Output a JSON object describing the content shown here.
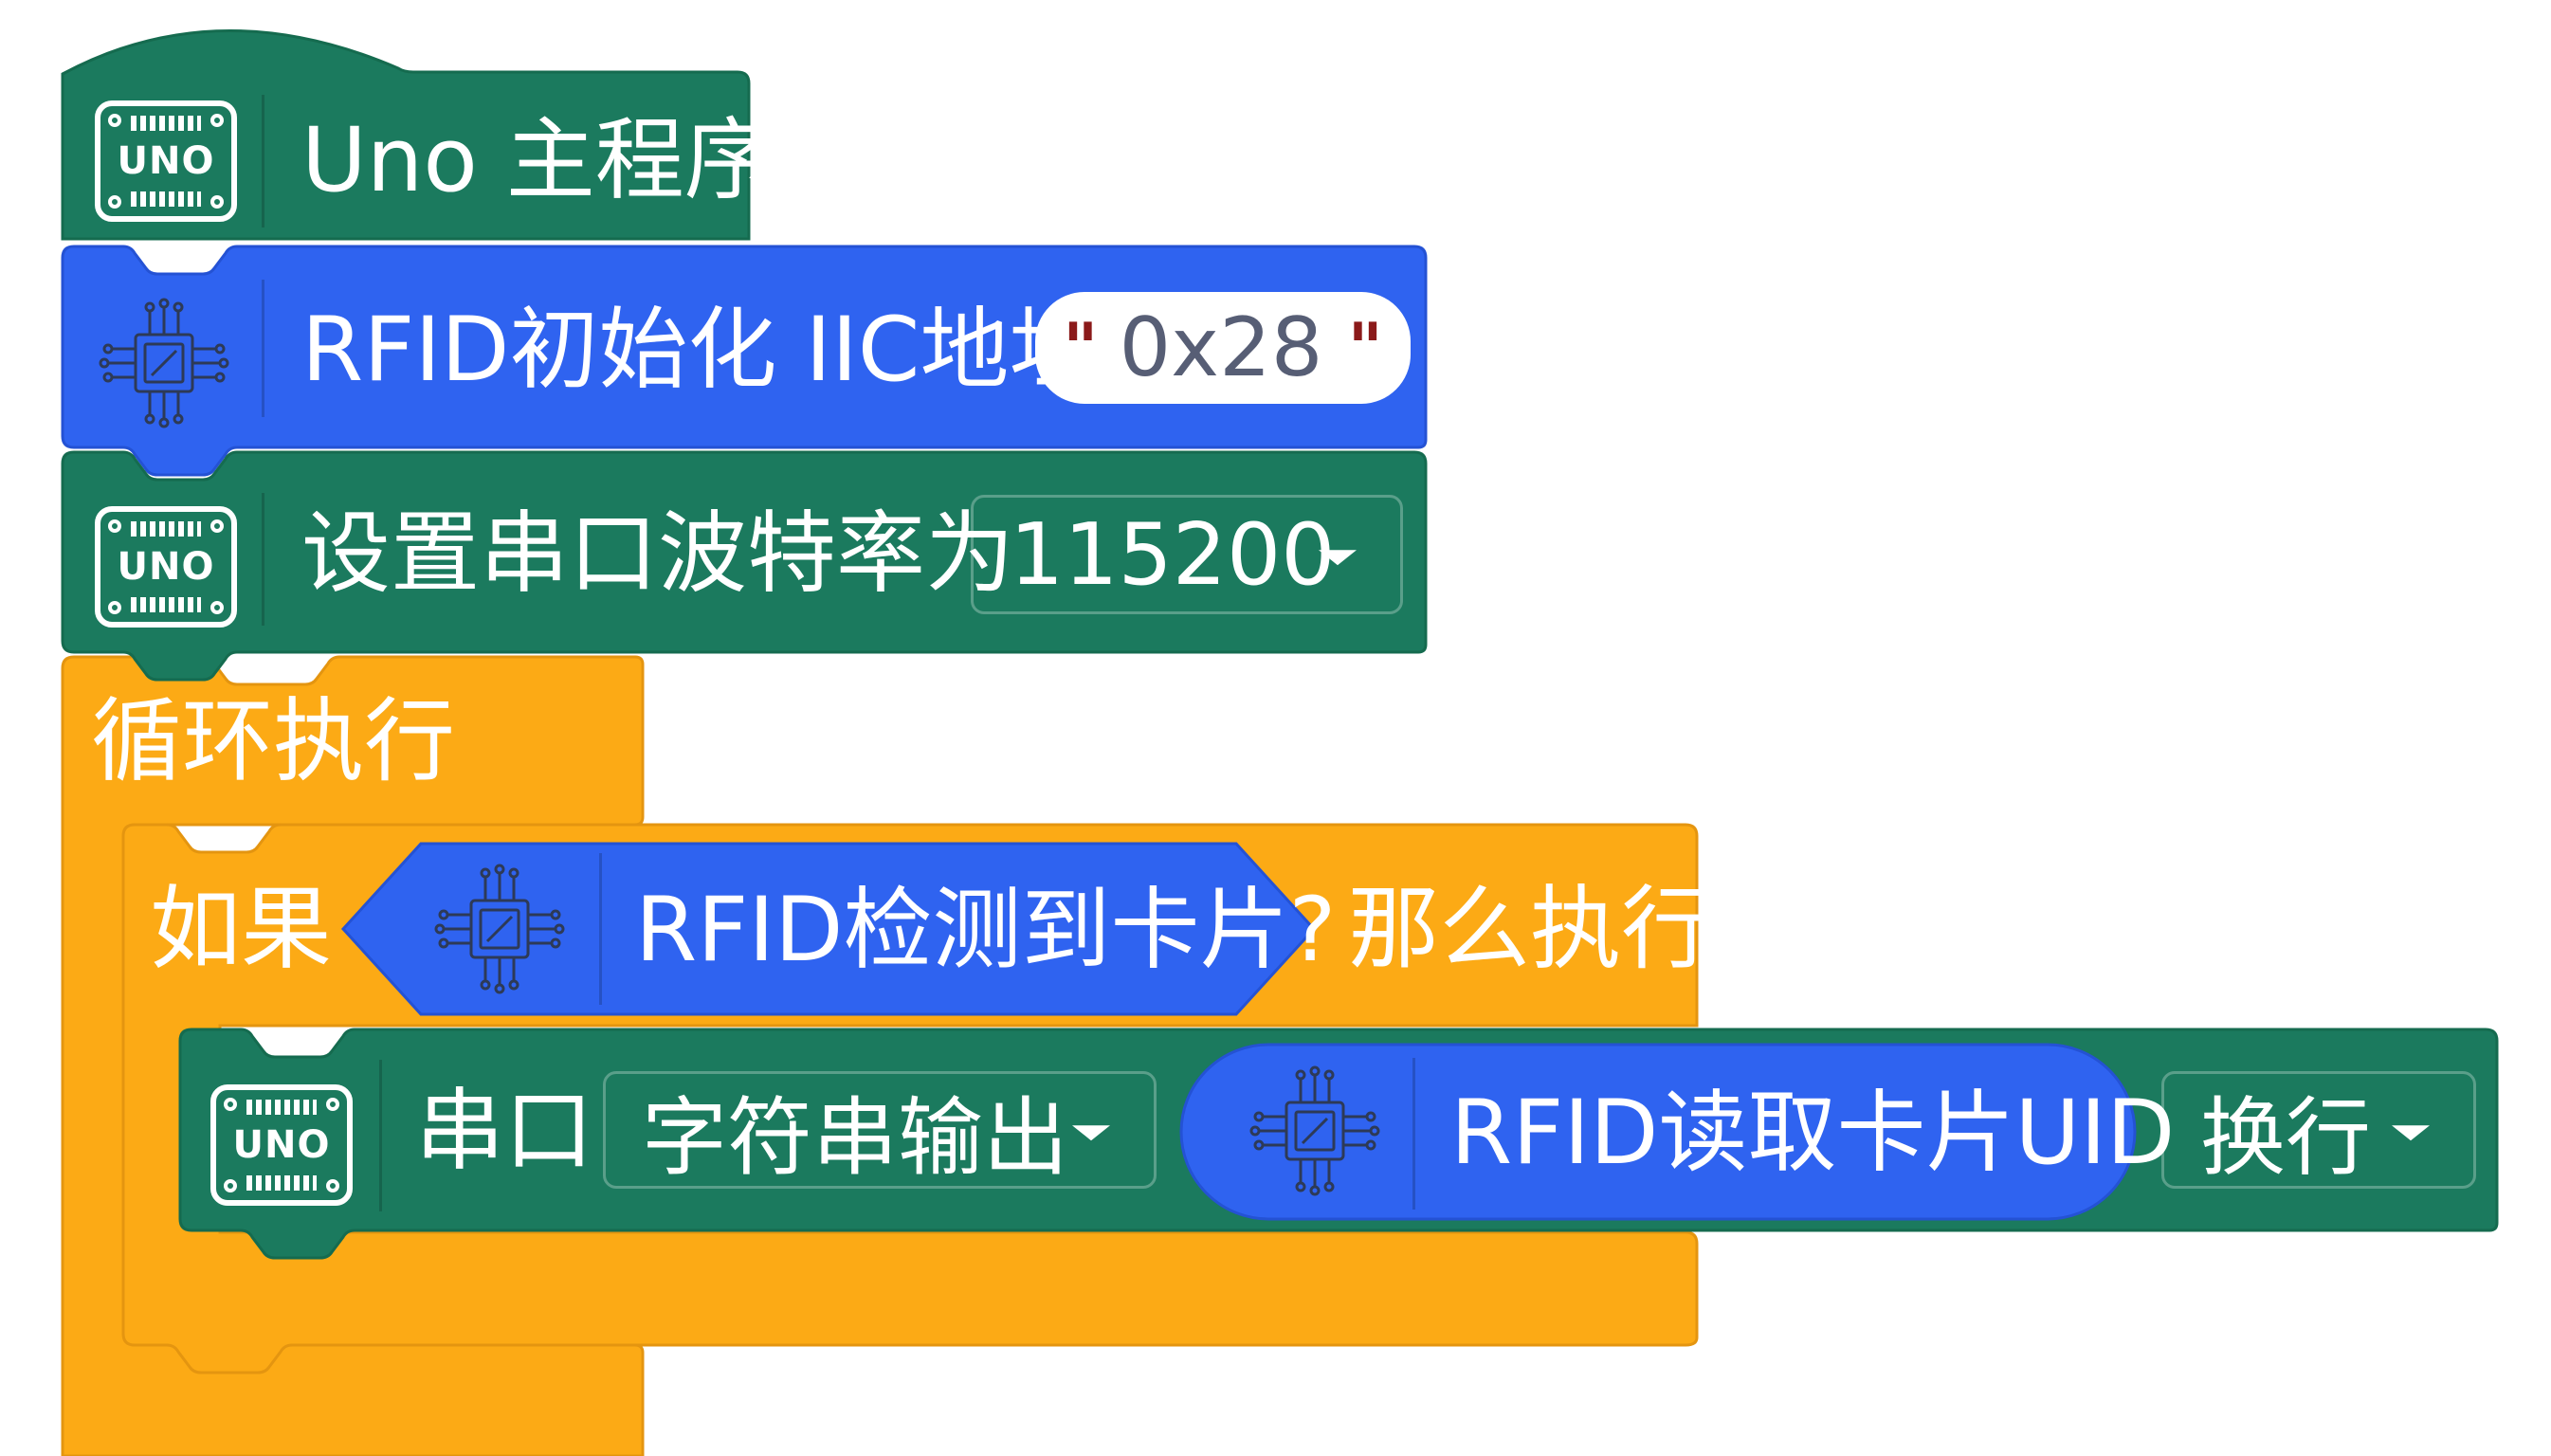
{
  "colors": {
    "green": "#1B7A5E",
    "green_border": "#156B4F",
    "blue": "#2F63F0",
    "blue_border": "#2452D4",
    "orange": "#FCAA15",
    "orange_border": "#E49510",
    "white": "#FFFFFF",
    "quote": "#8B1A1A"
  },
  "blocks": {
    "main": {
      "icon": "uno-board-icon",
      "icon_text": "UNO",
      "label": "Uno 主程序"
    },
    "rfid_init": {
      "icon": "chip-icon",
      "label": "RFID初始化 IIC地址",
      "address_quote_open": "\"",
      "address_value": "0x28",
      "address_quote_close": "\""
    },
    "serial_baud": {
      "icon": "uno-board-icon",
      "icon_text": "UNO",
      "label": "设置串口波特率为",
      "baud_value": "115200"
    },
    "loop": {
      "label": "循环执行"
    },
    "if_block": {
      "label": "如果",
      "condition_icon": "chip-icon",
      "condition_label": "RFID检测到卡片?",
      "then_label": "那么执行"
    },
    "serial_print": {
      "icon": "uno-board-icon",
      "icon_text": "UNO",
      "label": "串口",
      "mode_value": "字符串输出",
      "reporter_icon": "chip-icon",
      "reporter_label": "RFID读取卡片UID",
      "newline_value": "换行"
    }
  }
}
